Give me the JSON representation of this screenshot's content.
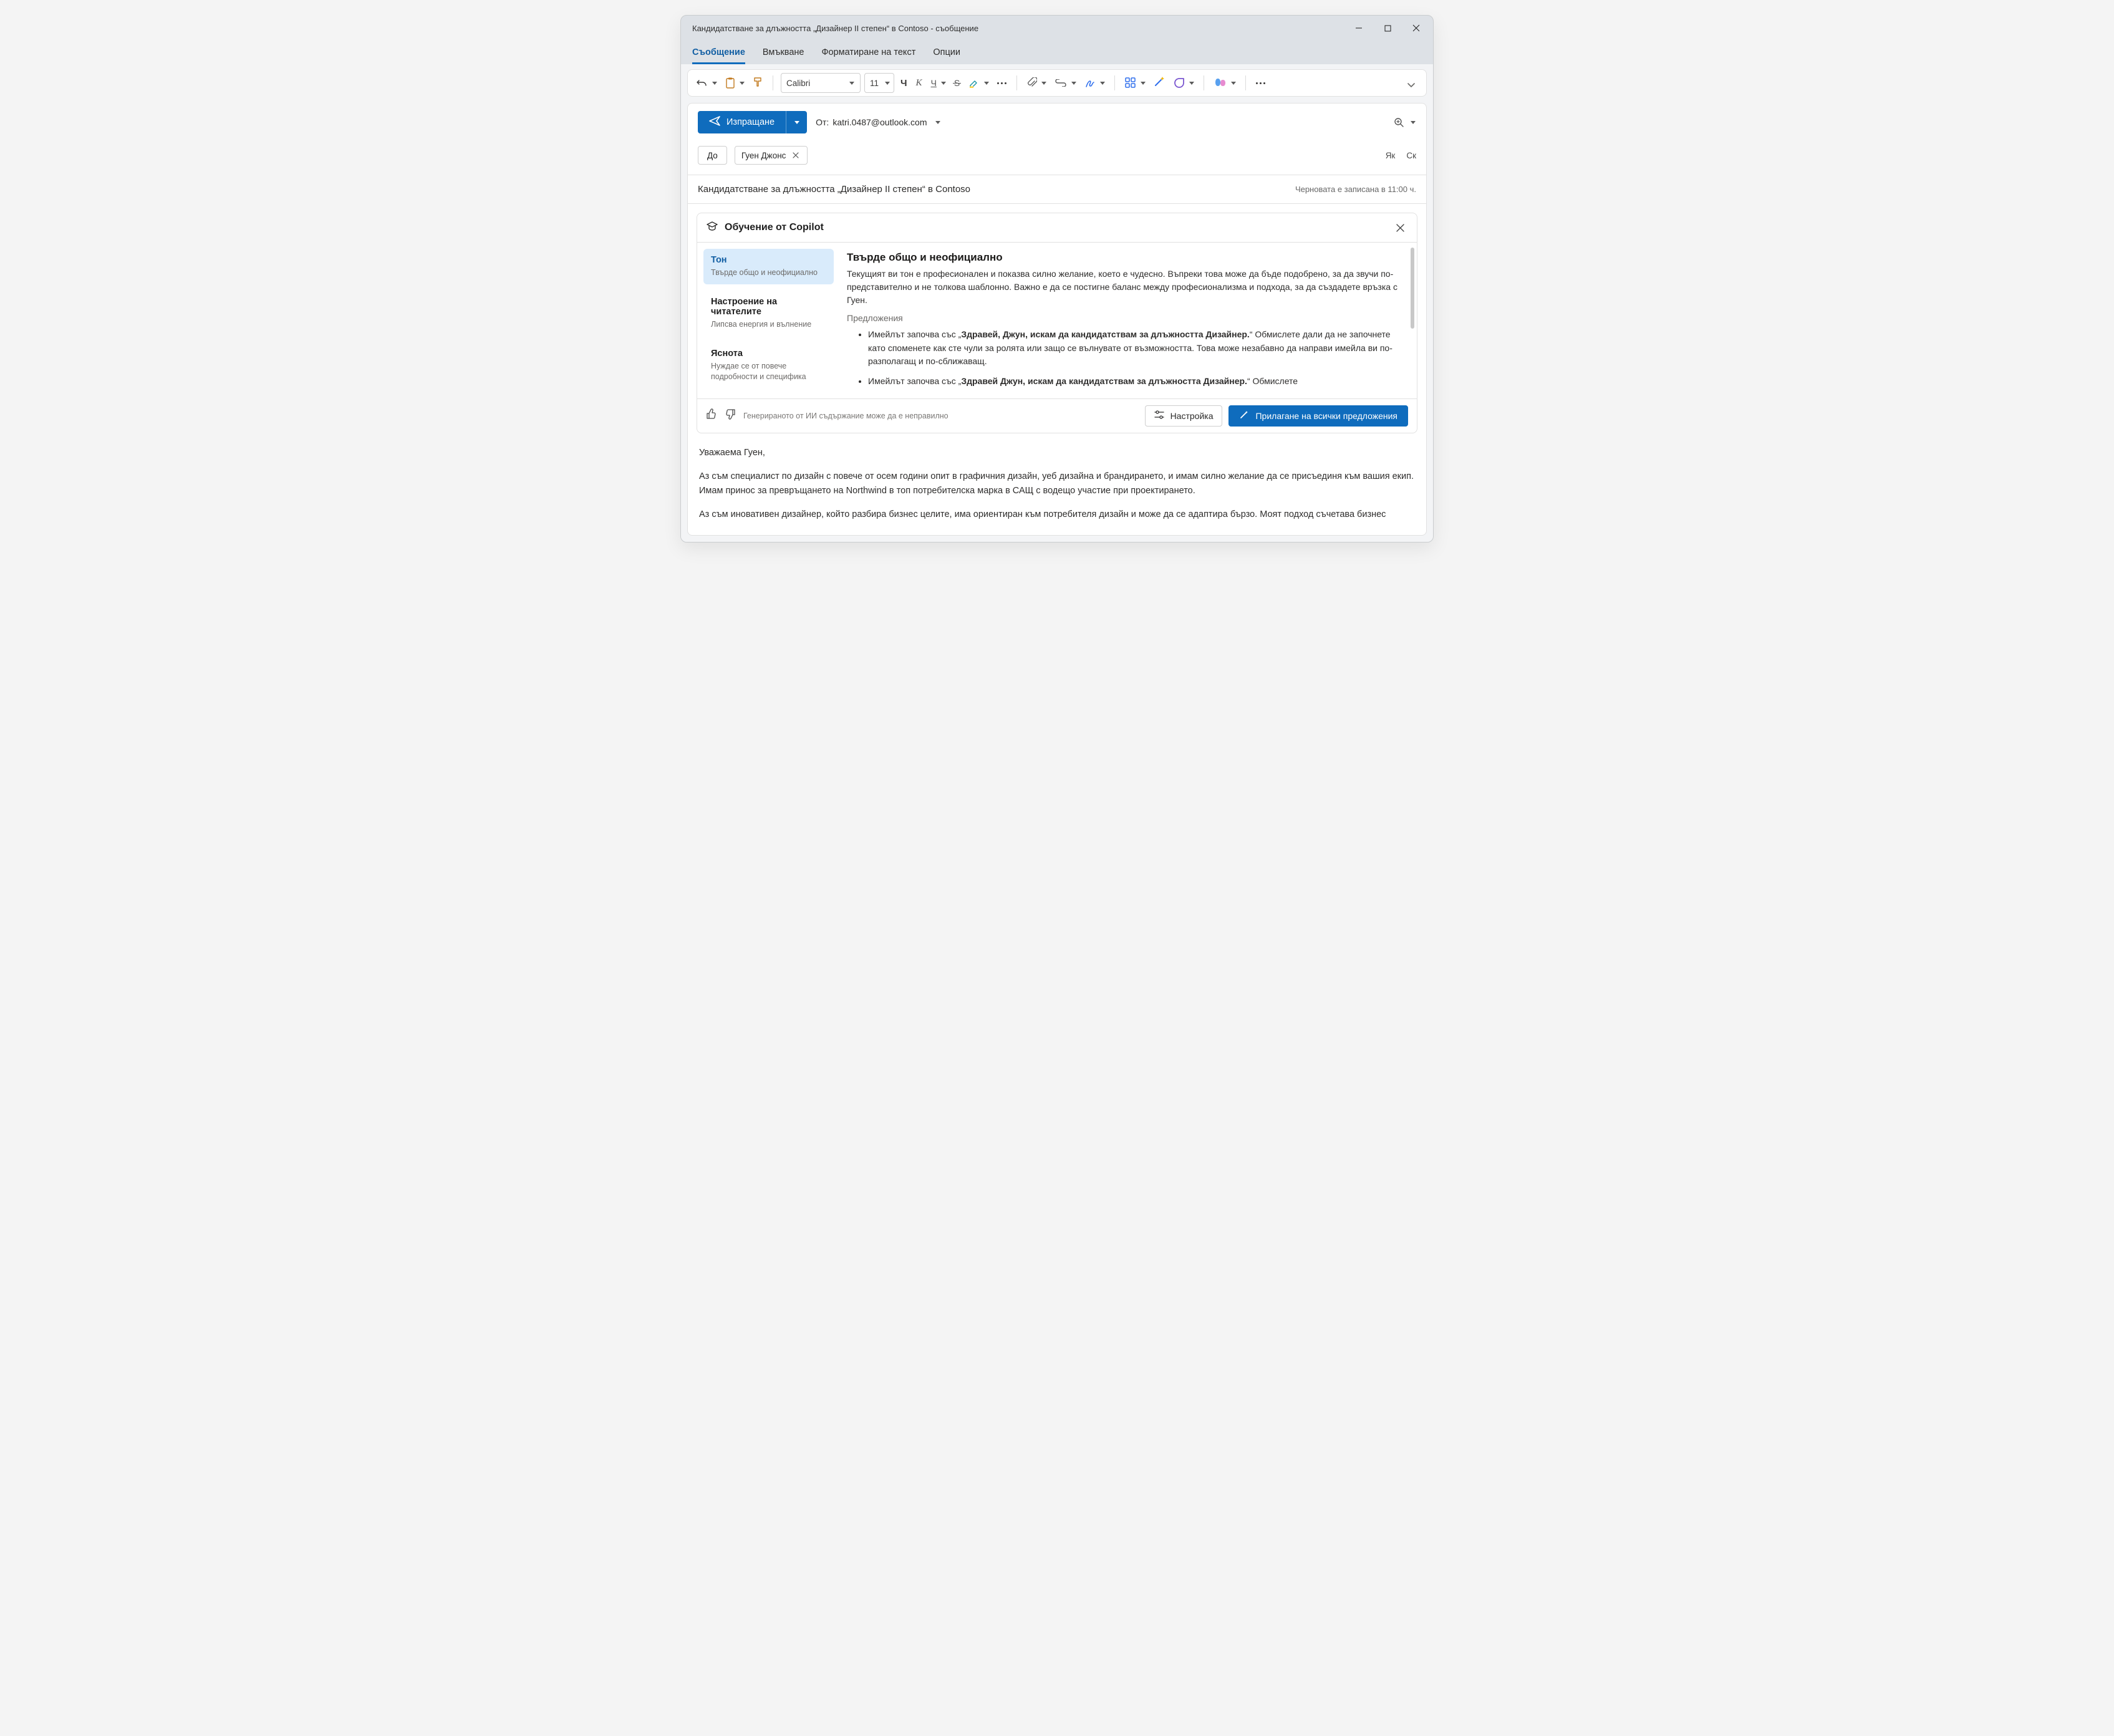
{
  "window": {
    "title": "Кандидатстване за длъжността „Дизайнер II степен“ в Contoso - съобщение"
  },
  "tabs": {
    "message": "Съобщение",
    "insert": "Вмъкване",
    "format": "Форматиране на текст",
    "options": "Опции"
  },
  "ribbon": {
    "font_name": "Calibri",
    "font_size": "11"
  },
  "compose": {
    "send_label": "Изпращане",
    "from_prefix": "От: ",
    "from_address": "katri.0487@outlook.com",
    "to_label": "До",
    "recipient_name": "Гуен Джонс",
    "cc_label": "Як",
    "bcc_label": "Ск",
    "subject": "Кандидатстване за длъжността „Дизайнер II степен“ в Contoso",
    "draft_saved": "Черновата е записана в 11:00 ч."
  },
  "copilot": {
    "title": "Обучение от Copilot",
    "nav": [
      {
        "title": "Тон",
        "desc": "Твърде общо и неофициално"
      },
      {
        "title": "Настроение на читателите",
        "desc": "Липсва енергия и вълнение"
      },
      {
        "title": "Яснота",
        "desc": "Нуждае се от повече подробности и специфика"
      }
    ],
    "analysis": {
      "heading": "Твърде общо и неофициално",
      "text": "Текущият ви тон е професионален и показва силно желание, което е чудесно. Въпреки това може да бъде подобрено, за да звучи по-представително и не толкова шаблонно. Важно е да се постигне баланс между професионализма и подхода, за да създадете връзка с Гуен.",
      "suggestions_label": "Предложения",
      "suggestions": [
        {
          "pre": "Имейлът започва със „",
          "bold": "Здравей, Джун, искам да кандидатствам за длъжността Дизайнер.",
          "post": "“ Обмислете дали да не започнете като споменете как сте чули за ролята или защо се вълнувате от възможността. Това може незабавно да направи имейла ви по-разполагащ и по-сближаващ."
        },
        {
          "pre": "Имейлът започва със „",
          "bold": "Здравей Джун, искам да кандидатствам за длъжността Дизайнер.",
          "post": "“ Обмислете"
        }
      ]
    },
    "footer": {
      "disclaimer": "Генерираното от ИИ съдържание може да е неправилно",
      "tune": "Настройка",
      "apply_all": "Прилагане на всички предложения"
    }
  },
  "email_body": {
    "greeting": "Уважаема Гуен,",
    "p1": "Аз съм специалист по дизайн с повече от осем години опит в графичния дизайн, уеб дизайна и брандирането, и имам силно желание да се присъединя към вашия екип. Имам принос за превръщането на Northwind в топ потребителска марка в САЩ с водещо участие при проектирането.",
    "p2": "Аз съм иновативен дизайнер, който разбира бизнес целите, има ориентиран към потребителя дизайн и може да се адаптира бързо. Моят подход съчетава бизнес целите с ориентиран към потребителя дизайн и адаптивност. Вълнувам се по повод на това как страстта ми към дизайна може да"
  }
}
